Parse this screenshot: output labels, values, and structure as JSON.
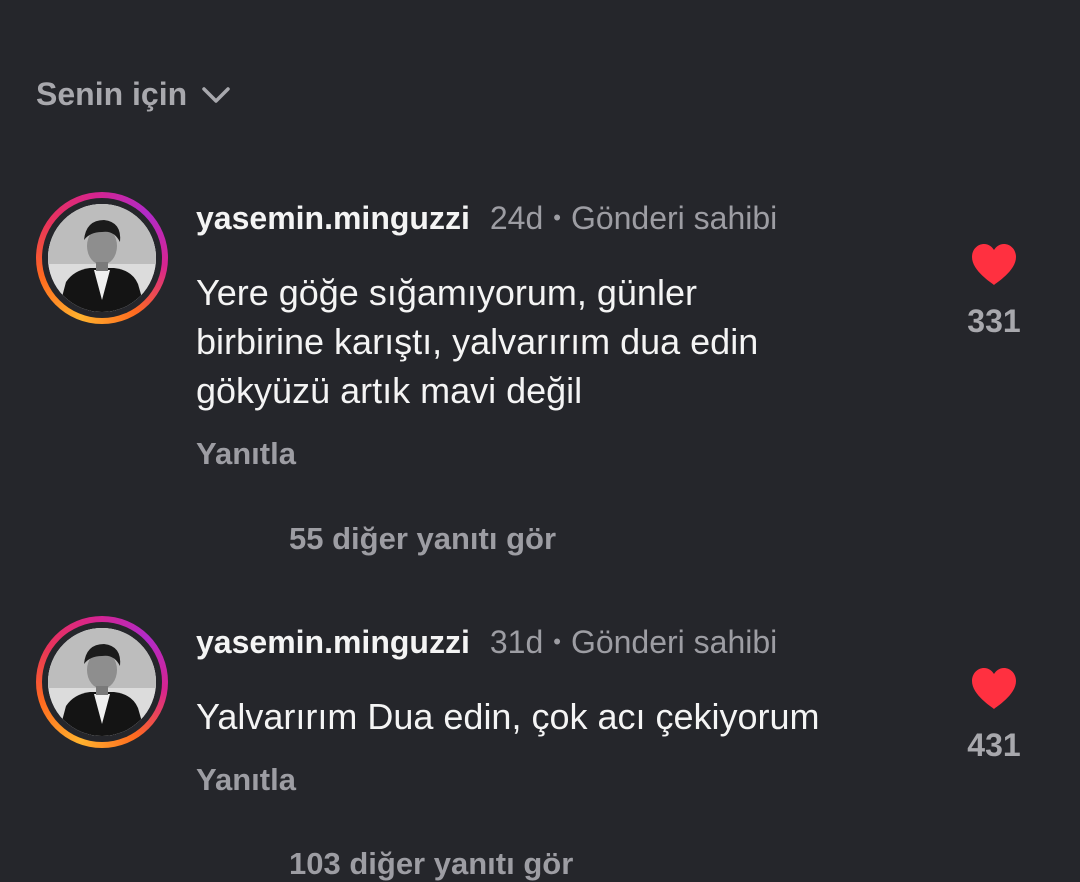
{
  "header": {
    "filter_label": "Senin için",
    "filter_icon": "chevron-down-icon"
  },
  "comments": [
    {
      "username": "yasemin.minguzzi",
      "time": "24d",
      "separator": "•",
      "owner_label": "Gönderi sahibi",
      "text": "Yere göğe sığamıyorum, günler\nbirbirine karıştı, yalvarırım dua edin\ngökyüzü artık mavi değil",
      "reply_label": "Yanıtla",
      "like_count": "331",
      "liked": true,
      "more_replies": "55 diğer yanıtı gör"
    },
    {
      "username": "yasemin.minguzzi",
      "time": "31d",
      "separator": "•",
      "owner_label": "Gönderi sahibi",
      "text": "Yalvarırım Dua edin, çok acı çekiyorum",
      "reply_label": "Yanıtla",
      "like_count": "431",
      "liked": true,
      "more_replies": "103 diğer yanıtı gör"
    }
  ],
  "colors": {
    "background": "#25262b",
    "heart": "#ff3040",
    "muted_text": "#9d9da3"
  }
}
